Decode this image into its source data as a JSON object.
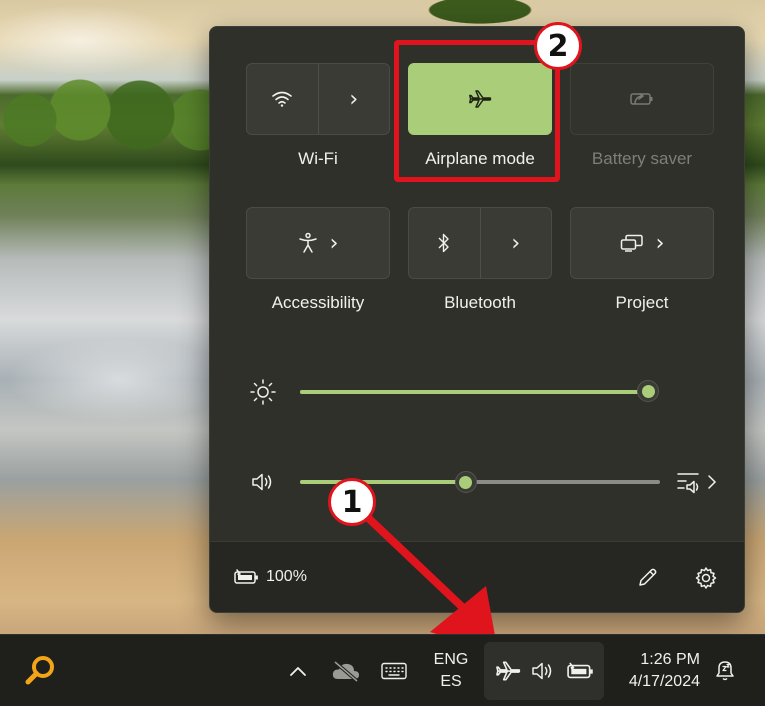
{
  "quick_settings": {
    "tiles": [
      {
        "id": "wifi",
        "label": "Wi-Fi",
        "state": "off",
        "icon": "wifi-icon",
        "has_chevron": true
      },
      {
        "id": "airplane",
        "label": "Airplane mode",
        "state": "on",
        "icon": "airplane-icon",
        "has_chevron": false
      },
      {
        "id": "battery_saver",
        "label": "Battery saver",
        "state": "disabled",
        "icon": "battery-saver-icon",
        "has_chevron": false
      },
      {
        "id": "accessibility",
        "label": "Accessibility",
        "state": "off",
        "icon": "accessibility-icon",
        "has_chevron": true
      },
      {
        "id": "bluetooth",
        "label": "Bluetooth",
        "state": "off",
        "icon": "bluetooth-icon",
        "has_chevron": true
      },
      {
        "id": "project",
        "label": "Project",
        "state": "off",
        "icon": "project-icon",
        "has_chevron": true
      }
    ],
    "brightness": {
      "icon": "brightness-icon",
      "level": 1.0
    },
    "volume": {
      "icon": "speaker-icon",
      "level": 0.46,
      "output_icon": "audio-output-icon"
    },
    "footer": {
      "battery_icon": "battery-charging-icon",
      "battery_percent": "100%",
      "edit_icon": "pencil-icon",
      "settings_icon": "gear-icon"
    }
  },
  "annotations": {
    "step1": "1",
    "step2": "2",
    "color": "#e0141d"
  },
  "taskbar": {
    "search_icon": "search-icon",
    "overflow_icon": "chevron-up-icon",
    "onedrive_icon": "cloud-offline-icon",
    "keyboard_icon": "keyboard-icon",
    "language_line1": "ENG",
    "language_line2": "ES",
    "tray_icons": [
      "airplane-icon",
      "speaker-icon",
      "battery-charging-icon"
    ],
    "time": "1:26 PM",
    "date": "4/17/2024",
    "notification_icon": "do-not-disturb-icon"
  },
  "colors": {
    "accent": "#a9cd78",
    "flyout_bg": "#2f302a",
    "taskbar_bg": "#1f201c"
  }
}
